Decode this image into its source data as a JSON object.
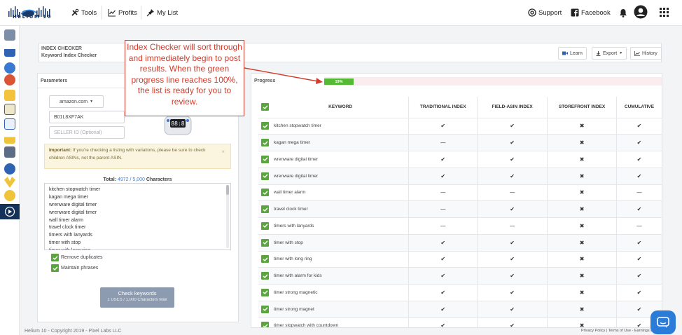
{
  "brand": {
    "name": "HELIUM 10"
  },
  "nav": {
    "items": [
      {
        "label": "Tools",
        "icon": "tools-icon"
      },
      {
        "label": "Profits",
        "icon": "chart-line-icon"
      },
      {
        "label": "My List",
        "icon": "pin-icon"
      }
    ],
    "right": [
      {
        "label": "Support",
        "icon": "lifebuoy-icon"
      },
      {
        "label": "Facebook",
        "icon": "facebook-icon"
      }
    ]
  },
  "header": {
    "title": "INDEX CHECKER",
    "subtitle": "Keyword Index Checker",
    "learn_label": "Learn",
    "export_label": "Export",
    "history_label": "History"
  },
  "params": {
    "title": "Parameters",
    "marketplace": "amazon.com",
    "asin": "B01L8XF7AK",
    "seller_placeholder": "SELLER ID (Optional)",
    "alert_bold": "Important:",
    "alert_text": " If you're checking a listing with variations, please be sure to check children ASINs, not the parent ASIN.",
    "alert_close": "×",
    "total_label": "Total:",
    "total_used": "4972",
    "total_sep": " / ",
    "total_max": "5,000",
    "total_unit": " Characters",
    "keywords_text": [
      "kitchen stopwatch timer",
      "kagan mega timer",
      "wrenware digital timer",
      "wrenware digital timer",
      "wall timer alarm",
      "travel clock timer",
      "timers with lanyards",
      "timer with stop",
      "timer with long ring"
    ],
    "remove_duplicates": "Remove duplicates",
    "maintain_phrases": "Maintain phrases",
    "submit_label": "Check keywords",
    "submit_sub": "1 USES / 1,000 Characters Max"
  },
  "progress": {
    "label": "Progress",
    "percent_text": "19%",
    "value": 0.19
  },
  "table": {
    "headers": [
      "KEYWORD",
      "TRADITIONAL INDEX",
      "FIELD-ASIN INDEX",
      "STOREFRONT INDEX",
      "CUMULATIVE"
    ],
    "rows": [
      [
        "kitchen stopwatch timer",
        "check",
        "check",
        "cross",
        "check"
      ],
      [
        "kagan mega timer",
        "dash",
        "check",
        "cross",
        "check"
      ],
      [
        "wrenware digital timer",
        "check",
        "check",
        "cross",
        "check"
      ],
      [
        "wrenware digital timer",
        "check",
        "check",
        "cross",
        "check"
      ],
      [
        "wall timer alarm",
        "dash",
        "dash",
        "cross",
        "dash"
      ],
      [
        "travel clock timer",
        "dash",
        "check",
        "cross",
        "check"
      ],
      [
        "timers with lanyards",
        "dash",
        "dash",
        "cross",
        "dash"
      ],
      [
        "timer with stop",
        "check",
        "check",
        "cross",
        "check"
      ],
      [
        "timer with long ring",
        "check",
        "check",
        "cross",
        "check"
      ],
      [
        "timer with alarm for kids",
        "check",
        "check",
        "cross",
        "check"
      ],
      [
        "timer strong magnetic",
        "check",
        "check",
        "cross",
        "check"
      ],
      [
        "timer strong magnet",
        "check",
        "check",
        "cross",
        "check"
      ],
      [
        "timer stopwatch with countdown",
        "check",
        "check",
        "cross",
        "check"
      ]
    ]
  },
  "callout": {
    "text": "Index Checker will sort through and immediately begin to post results. When the green progress line reaches 100%, the list is ready for you to review."
  },
  "footer": {
    "left": "Helium 10 - Copyright 2019 - Pixel Labs LLC",
    "right": "Privacy Policy | Terms of Use - Earnings Disclaimer"
  },
  "colors": {
    "accent": "#5aa63c",
    "brand_dark": "#14315a",
    "annotation": "#d23b2b",
    "progress_track": "#fbecef",
    "button": "#8d9bb1"
  }
}
